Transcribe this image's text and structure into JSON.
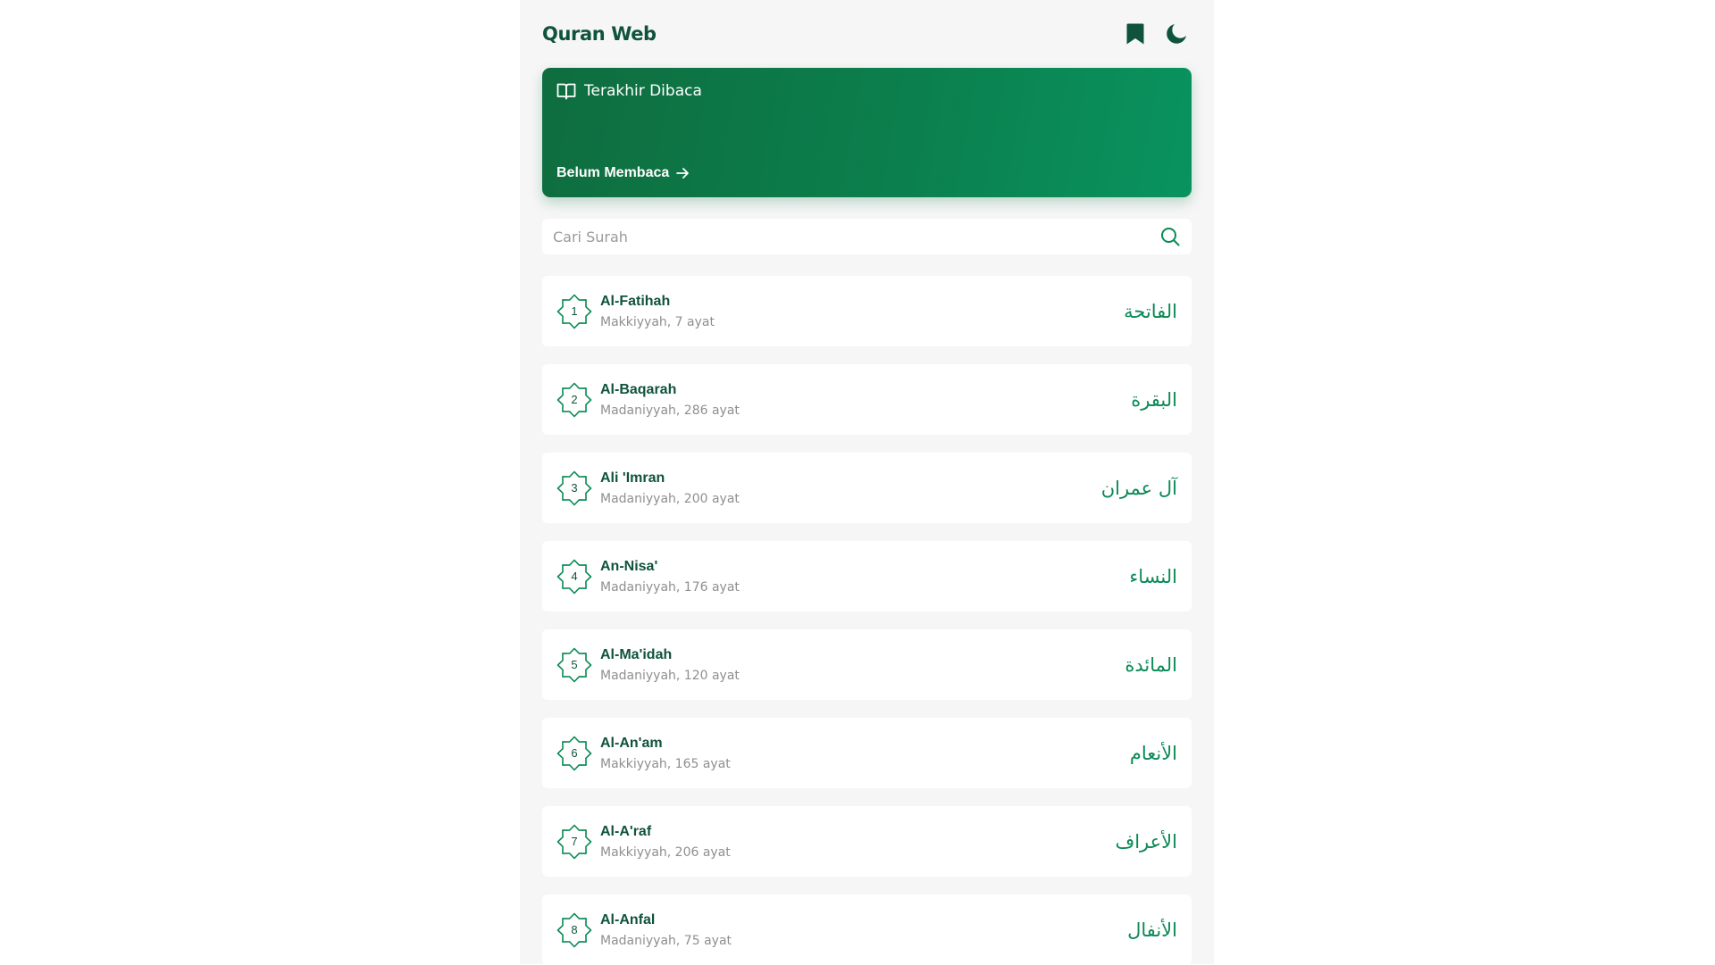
{
  "app": {
    "title": "Quran Web",
    "accent_color": "#0b8a55",
    "text_color": "#10533c"
  },
  "header": {
    "bookmark_icon": "bookmark-icon",
    "theme_icon": "moon-icon"
  },
  "last_read": {
    "icon": "book-open-icon",
    "title": "Terakhir Dibaca",
    "link_label": "Belum Membaca",
    "link_icon": "arrow-right-icon"
  },
  "search": {
    "placeholder": "Cari Surah",
    "value": "",
    "icon": "search-icon"
  },
  "surahs": [
    {
      "number": "1",
      "name": "Al-Fatihah",
      "meta": "Makkiyyah, 7 ayat",
      "arabic": "الفاتحة"
    },
    {
      "number": "2",
      "name": "Al-Baqarah",
      "meta": "Madaniyyah, 286 ayat",
      "arabic": "البقرة"
    },
    {
      "number": "3",
      "name": "Ali 'Imran",
      "meta": "Madaniyyah, 200 ayat",
      "arabic": "آل عمران"
    },
    {
      "number": "4",
      "name": "An-Nisa'",
      "meta": "Madaniyyah, 176 ayat",
      "arabic": "النساء"
    },
    {
      "number": "5",
      "name": "Al-Ma'idah",
      "meta": "Madaniyyah, 120 ayat",
      "arabic": "المائدة"
    },
    {
      "number": "6",
      "name": "Al-An'am",
      "meta": "Makkiyyah, 165 ayat",
      "arabic": "الأنعام"
    },
    {
      "number": "7",
      "name": "Al-A'raf",
      "meta": "Makkiyyah, 206 ayat",
      "arabic": "الأعراف"
    },
    {
      "number": "8",
      "name": "Al-Anfal",
      "meta": "Madaniyyah, 75 ayat",
      "arabic": "الأنفال"
    }
  ]
}
